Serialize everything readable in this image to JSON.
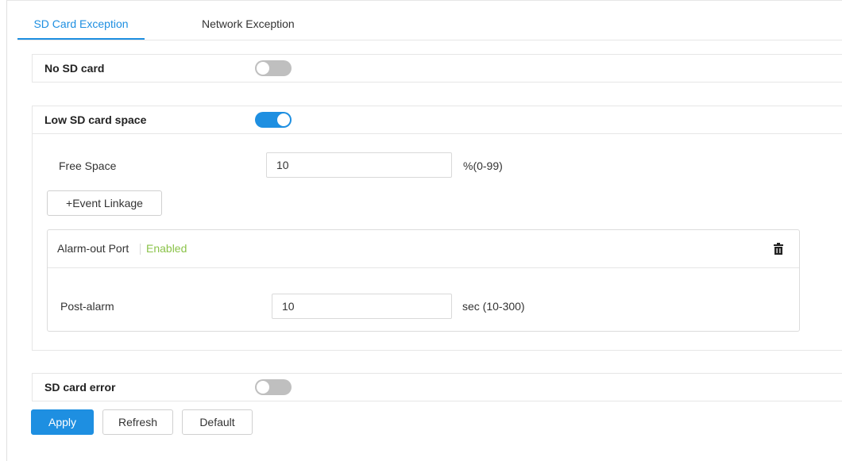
{
  "tabs": [
    {
      "label": "SD Card Exception",
      "active": true
    },
    {
      "label": "Network Exception",
      "active": false
    }
  ],
  "no_sd_card": {
    "title": "No SD card",
    "enabled": false
  },
  "low_space": {
    "title": "Low SD card space",
    "enabled": true,
    "free_space_label": "Free Space",
    "free_space_value": "10",
    "free_space_hint": "%(0-99)",
    "event_linkage_label": "+Event Linkage",
    "alarm_out": {
      "title": "Alarm-out Port",
      "status": "Enabled",
      "status_color": "#8bc34a",
      "post_alarm_label": "Post-alarm",
      "post_alarm_value": "10",
      "post_alarm_hint": "sec (10-300)",
      "delete_icon": "trash-icon"
    }
  },
  "sd_card_error": {
    "title": "SD card error",
    "enabled": false
  },
  "actions": {
    "apply": "Apply",
    "refresh": "Refresh",
    "default": "Default"
  },
  "colors": {
    "accent": "#1e8fe1",
    "toggle_off": "#bfbfbf"
  }
}
